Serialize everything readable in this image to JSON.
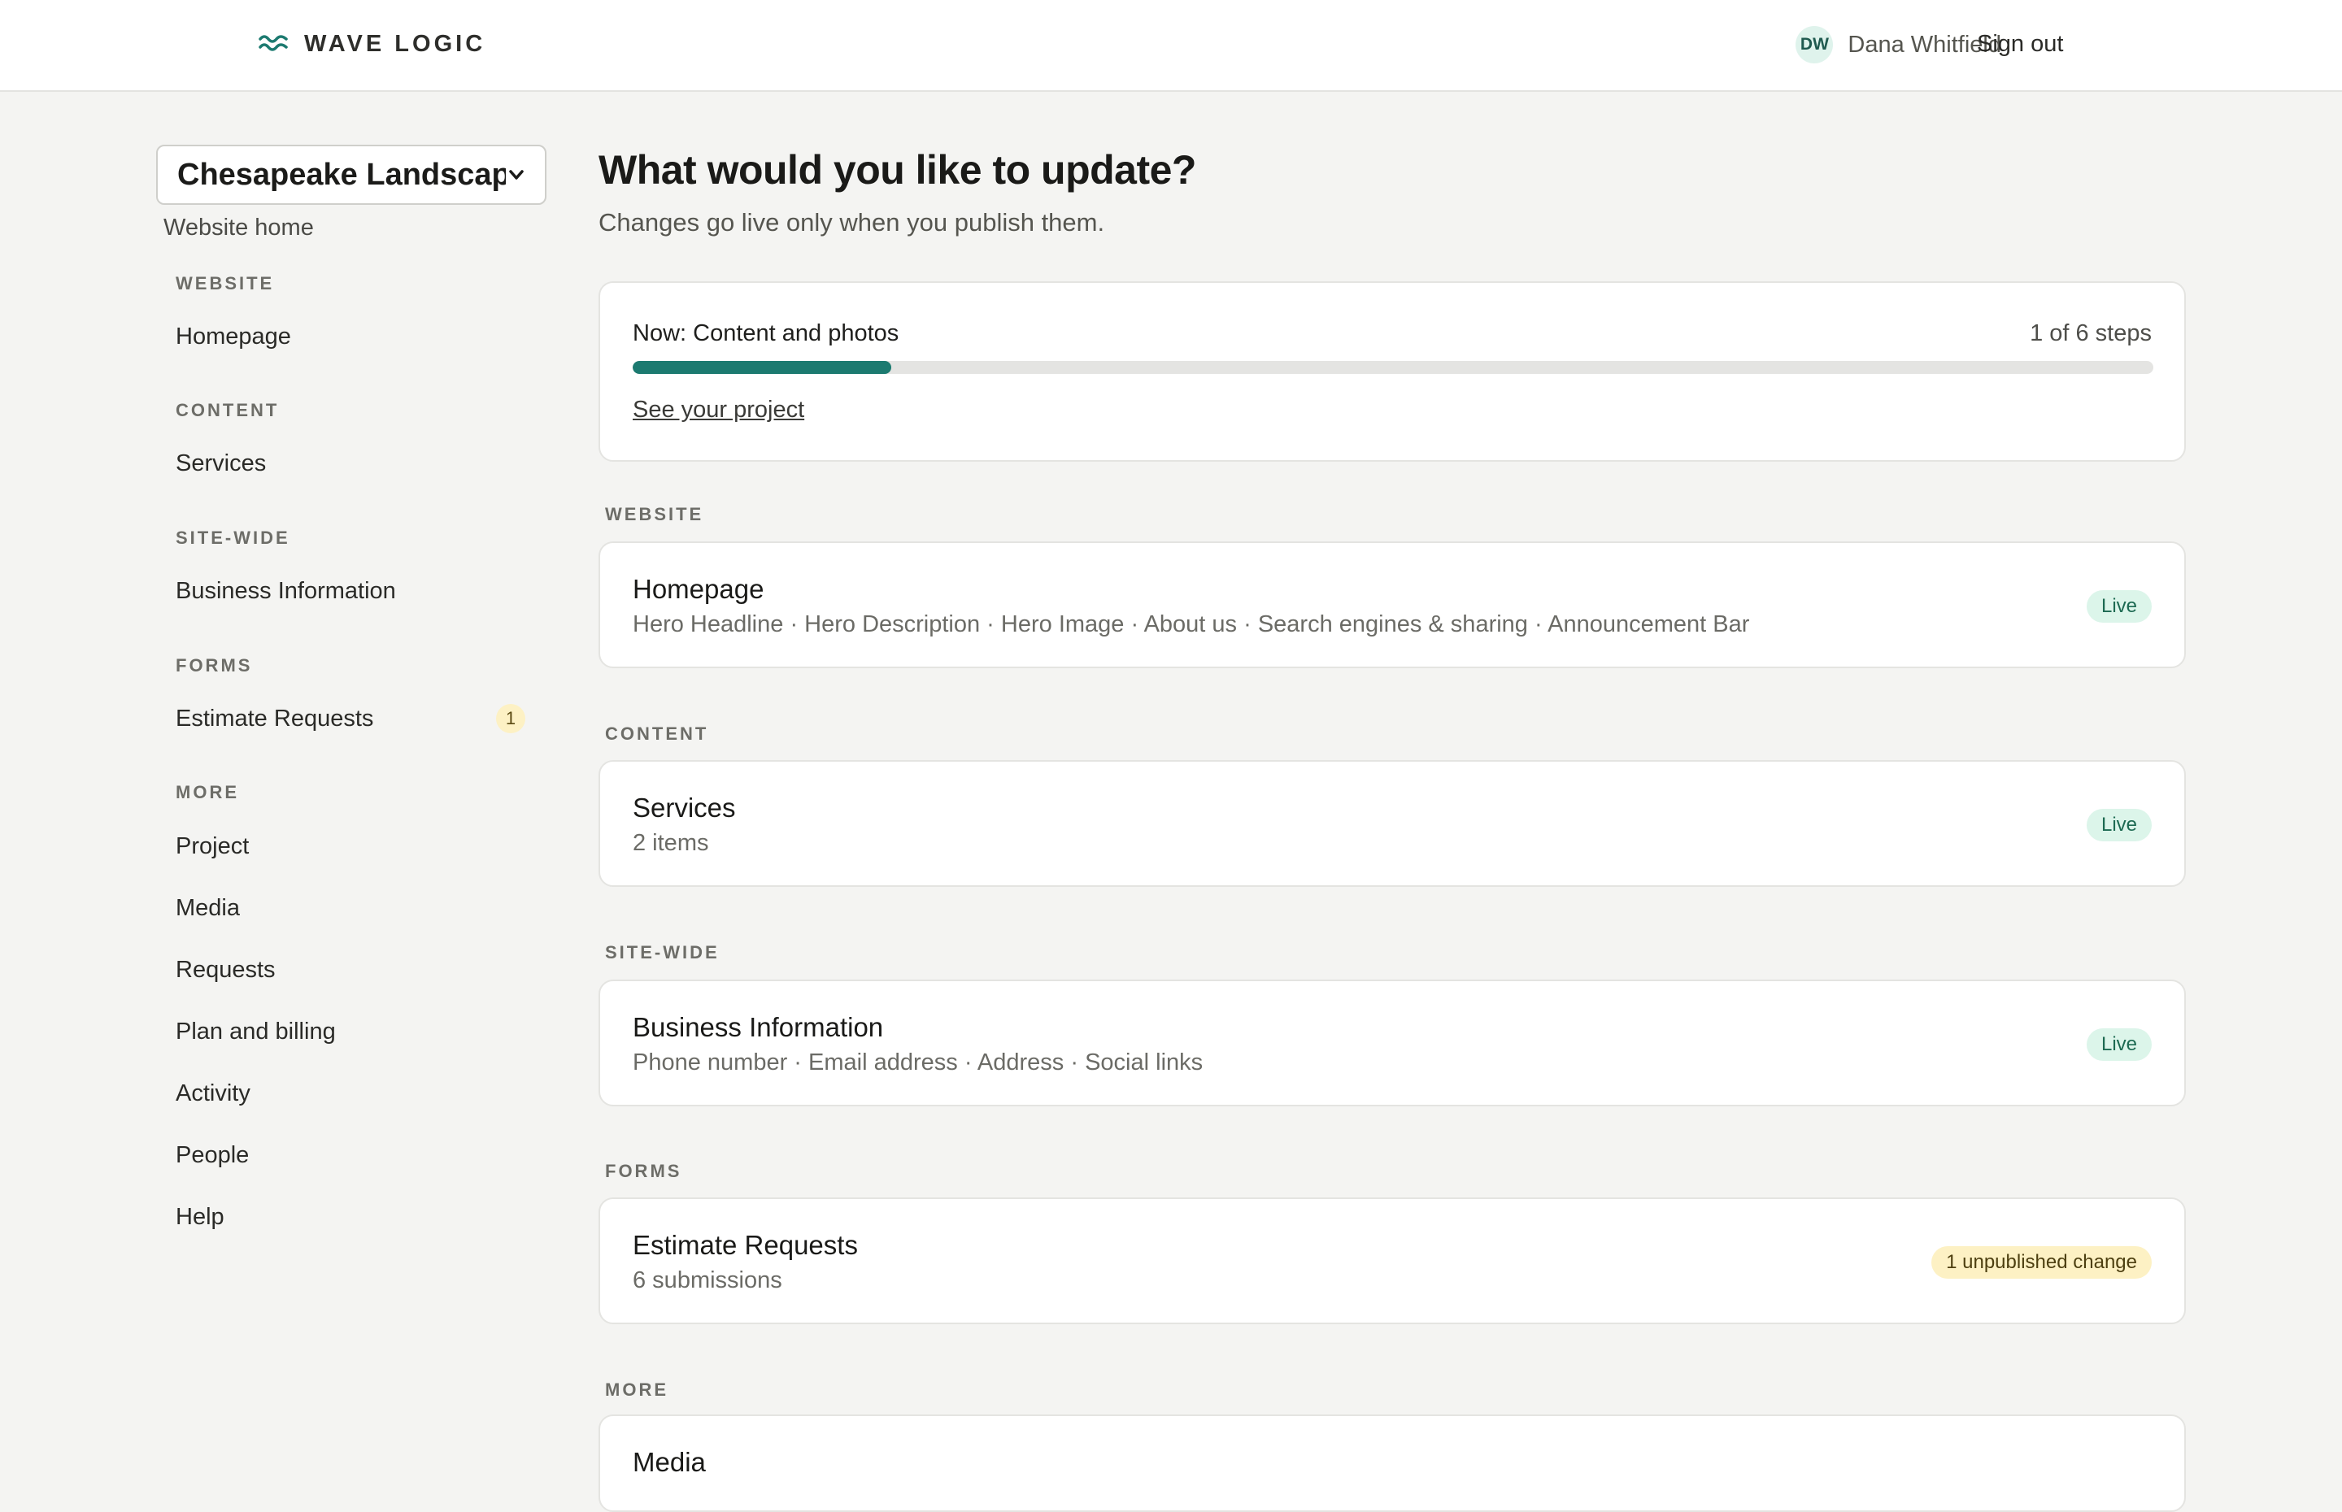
{
  "header": {
    "brand": "WAVE LOGIC",
    "user_initials": "DW",
    "user_name": "Dana Whitfield",
    "sign_out": "Sign out"
  },
  "sidebar": {
    "site_selector": "Chesapeake Landscapi...",
    "website_home": "Website home",
    "sections": [
      {
        "label": "WEBSITE",
        "items": [
          "Homepage"
        ]
      },
      {
        "label": "CONTENT",
        "items": [
          "Services"
        ]
      },
      {
        "label": "SITE-WIDE",
        "items": [
          "Business Information"
        ]
      },
      {
        "label": "FORMS",
        "items": [
          "Estimate Requests"
        ],
        "badge": "1"
      },
      {
        "label": "MORE",
        "items": [
          "Project",
          "Media",
          "Requests",
          "Plan and billing",
          "Activity",
          "People",
          "Help"
        ]
      }
    ]
  },
  "main": {
    "title": "What would you like to update?",
    "subtitle": "Changes go live only when you publish them.",
    "progress": {
      "label": "Now: Content and photos",
      "steps": "1 of 6 steps",
      "fraction": 0.17,
      "link": "See your project"
    },
    "groups": [
      {
        "label": "WEBSITE",
        "title": "Homepage",
        "desc": "Hero Headline · Hero Description · Hero Image · About us · Search engines & sharing · Announcement Bar",
        "status": "Live"
      },
      {
        "label": "CONTENT",
        "title": "Services",
        "desc": "2 items",
        "status": "Live"
      },
      {
        "label": "SITE-WIDE",
        "title": "Business Information",
        "desc": "Phone number · Email address · Address · Social links",
        "status": "Live"
      },
      {
        "label": "FORMS",
        "title": "Estimate Requests",
        "desc": "6 submissions",
        "status": "1 unpublished change"
      },
      {
        "label": "MORE",
        "title": "Media"
      }
    ]
  },
  "colors": {
    "accent": "#1c7a70",
    "live_bg": "#dcf5ea",
    "unpublished_bg": "#fdf1c4",
    "page_bg": "#f4f4f2"
  }
}
